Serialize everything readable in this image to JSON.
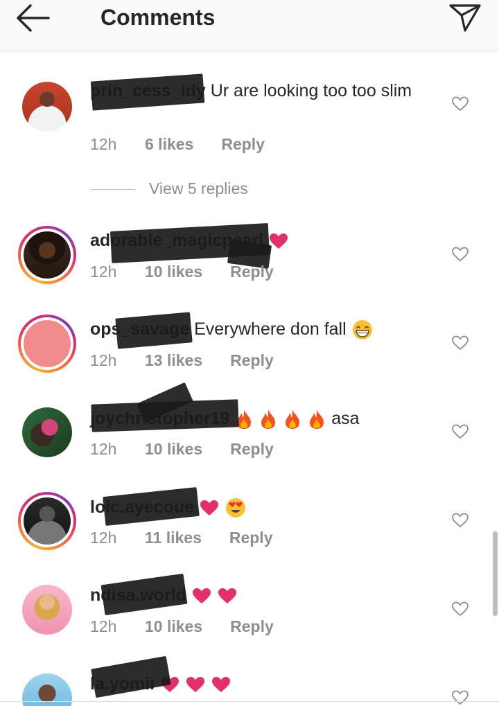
{
  "header": {
    "title": "Comments",
    "back_icon": "arrow-left-icon",
    "send_icon": "send-icon"
  },
  "comments": [
    {
      "username": "prin_cess_idy",
      "text": "Ur are looking too too slim",
      "time": "12h",
      "likes": "6 likes",
      "reply": "Reply",
      "avatar_story_ring": false
    },
    {
      "username": "adorable_magicpearl",
      "text": "",
      "emoji": [
        "heart"
      ],
      "time": "12h",
      "likes": "10 likes",
      "reply": "Reply",
      "avatar_story_ring": true
    },
    {
      "username": "ops_savage",
      "text": "Everywhere don fall",
      "emoji": [
        "grinning-face"
      ],
      "time": "12h",
      "likes": "13 likes",
      "reply": "Reply",
      "avatar_story_ring": true
    },
    {
      "username": "joychristopher19",
      "text": "asa",
      "emoji": [
        "fire",
        "fire",
        "fire",
        "fire"
      ],
      "time": "12h",
      "likes": "10 likes",
      "reply": "Reply",
      "avatar_story_ring": false
    },
    {
      "username": "loic.ayecoue",
      "text": "",
      "emoji": [
        "heart",
        "heart-eyes"
      ],
      "time": "12h",
      "likes": "11 likes",
      "reply": "Reply",
      "avatar_story_ring": true
    },
    {
      "username": "ndisa.world",
      "text": "",
      "emoji": [
        "heart",
        "heart"
      ],
      "time": "12h",
      "likes": "10 likes",
      "reply": "Reply",
      "avatar_story_ring": false
    },
    {
      "username": "la.yomii",
      "text": "",
      "emoji": [
        "heart",
        "heart",
        "heart"
      ],
      "avatar_story_ring": false
    }
  ],
  "view_replies": "View 5 replies",
  "colors": {
    "heart": "#e1306c",
    "fire": "#f4511e",
    "secondary_text": "#8e8e8e",
    "header_bg": "#fafafa"
  }
}
